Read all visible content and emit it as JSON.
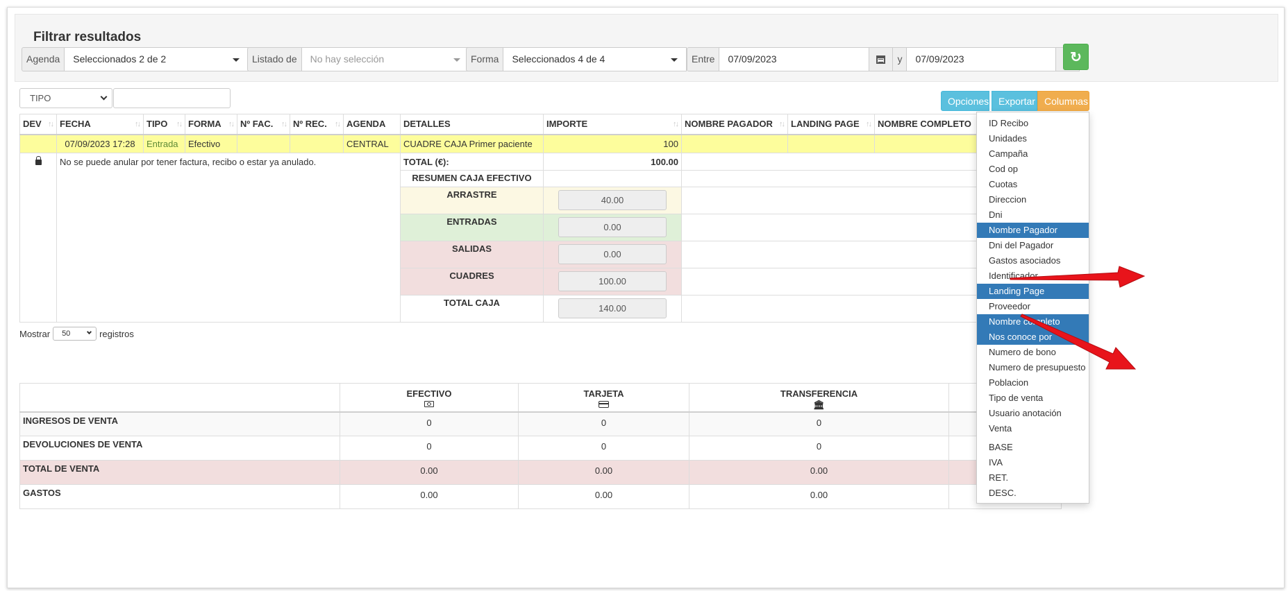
{
  "filters": {
    "title": "Filtrar resultados",
    "agenda_label": "Agenda",
    "agenda_value": "Seleccionados 2 de 2",
    "listado_label": "Listado de",
    "listado_value": "No hay selección",
    "forma_label": "Forma",
    "forma_value": "Seleccionados 4 de 4",
    "entre_label": "Entre",
    "date_from": "07/09/2023",
    "y_label": "y",
    "date_to": "07/09/2023"
  },
  "toolbar": {
    "tipo_select": "TIPO",
    "opciones": "Opciones",
    "exportar": "Exportar",
    "columnas": "Columnas"
  },
  "table": {
    "headers": [
      "DEV",
      "FECHA",
      "TIPO",
      "FORMA",
      "Nº FAC.",
      "Nº REC.",
      "AGENDA",
      "DETALLES",
      "IMPORTE",
      "NOMBRE PAGADOR",
      "LANDING PAGE",
      "NOMBRE COMPLETO"
    ],
    "row": {
      "fecha": "07/09/2023 17:28",
      "tipo": "Entrada",
      "forma": "Efectivo",
      "agenda": "CENTRAL",
      "detalles": "CUADRE CAJA Primer paciente",
      "importe": "100"
    },
    "lock_message": "No se puede anular por tener factura, recibo o estar ya anulado.",
    "total_label": "TOTAL (€):",
    "total_value": "100.00",
    "resumen_label": "RESUMEN CAJA EFECTIVO",
    "resumen": [
      {
        "label": "ARRASTRE",
        "value": "40.00"
      },
      {
        "label": "ENTRADAS",
        "value": "0.00"
      },
      {
        "label": "SALIDAS",
        "value": "0.00"
      },
      {
        "label": "CUADRES",
        "value": "100.00"
      },
      {
        "label": "TOTAL CAJA",
        "value": "140.00"
      }
    ]
  },
  "pagination": {
    "mostrar": "Mostrar",
    "length": "50",
    "registros": "registros"
  },
  "summary": {
    "headers": [
      "EFECTIVO",
      "TARJETA",
      "TRANSFERENCIA"
    ],
    "rows": [
      {
        "label": "INGRESOS DE VENTA",
        "values": [
          "0",
          "0",
          "0"
        ]
      },
      {
        "label": "DEVOLUCIONES DE VENTA",
        "values": [
          "0",
          "0",
          "0"
        ]
      },
      {
        "label": "TOTAL DE VENTA",
        "values": [
          "0.00",
          "0.00",
          "0.00"
        ]
      },
      {
        "label": "GASTOS",
        "values": [
          "0.00",
          "0.00",
          "0.00"
        ]
      }
    ]
  },
  "columns_menu": {
    "items": [
      {
        "label": "ID Recibo",
        "active": false
      },
      {
        "label": "Unidades",
        "active": false
      },
      {
        "label": "Campaña",
        "active": false
      },
      {
        "label": "Cod op",
        "active": false
      },
      {
        "label": "Cuotas",
        "active": false
      },
      {
        "label": "Direccion",
        "active": false
      },
      {
        "label": "Dni",
        "active": false
      },
      {
        "label": "Nombre Pagador",
        "active": true
      },
      {
        "label": "Dni del Pagador",
        "active": false
      },
      {
        "label": "Gastos asociados",
        "active": false
      },
      {
        "label": "Identificador",
        "active": false
      },
      {
        "label": "Landing Page",
        "active": true
      },
      {
        "label": "Proveedor",
        "active": false
      },
      {
        "label": "Nombre completo",
        "active": true
      },
      {
        "label": "Nos conoce por",
        "active": true
      },
      {
        "label": "Numero de bono",
        "active": false
      },
      {
        "label": "Numero de presupuesto",
        "active": false
      },
      {
        "label": "Poblacion",
        "active": false
      },
      {
        "label": "Tipo de venta",
        "active": false
      },
      {
        "label": "Usuario anotación",
        "active": false
      },
      {
        "label": "Venta",
        "active": false
      }
    ],
    "items2": [
      {
        "label": "BASE"
      },
      {
        "label": "IVA"
      },
      {
        "label": "RET."
      },
      {
        "label": "DESC."
      }
    ]
  },
  "colors": {
    "highlight_row": "#fdfd9c",
    "menu_active": "#337ab7",
    "btn_info": "#5bc0de",
    "btn_warning": "#f0ad4e",
    "btn_success": "#5cb85c",
    "arrow": "#e8141b"
  },
  "icons": {
    "refresh": "refresh-icon",
    "calendar": "calendar-icon",
    "lock": "lock-icon",
    "efectivo": "money-icon",
    "tarjeta": "credit-card-icon",
    "transferencia": "bank-icon"
  }
}
